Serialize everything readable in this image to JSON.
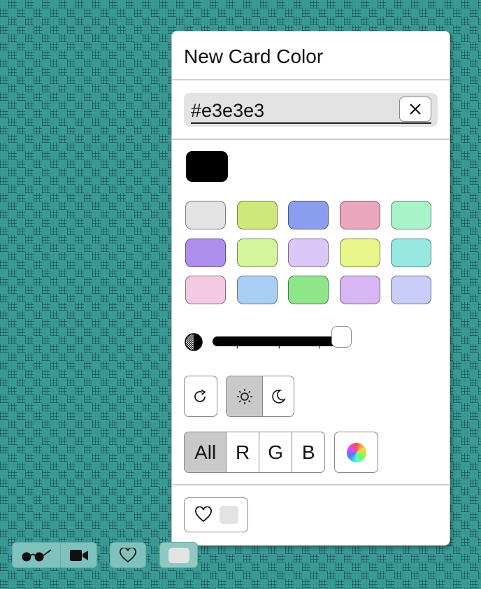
{
  "panel": {
    "title": "New Card Color",
    "hex_value": "#e3e3e3",
    "clear_icon": "close-icon",
    "selected_color": "#000000",
    "palette": [
      [
        "#e3e3e3",
        "#d0e87b",
        "#8c9ef0",
        "#e9a8be",
        "#a9f3c9"
      ],
      [
        "#ad90ee",
        "#d5f59d",
        "#dcc8f6",
        "#e8f58b",
        "#97e9e0"
      ],
      [
        "#f4c9e4",
        "#a9cff5",
        "#8ee58a",
        "#d9b7f4",
        "#c9ccf6"
      ]
    ],
    "brightness": 1.0,
    "reset_icon": "rotate-icon",
    "theme": {
      "light_icon": "sun-icon",
      "dark_icon": "moon-icon",
      "selected": "light"
    },
    "channels": [
      "All",
      "R",
      "G",
      "B"
    ],
    "selected_channel": "All",
    "color_wheel_icon": "color-wheel-icon",
    "favorite": {
      "icon": "heart-icon",
      "color": "#e3e3e3"
    }
  },
  "toolbar": {
    "view_icon": "glasses-icon",
    "camera_icon": "video-camera-icon",
    "favorites_icon": "heart-icon",
    "card_color": "#e3e3e3"
  }
}
